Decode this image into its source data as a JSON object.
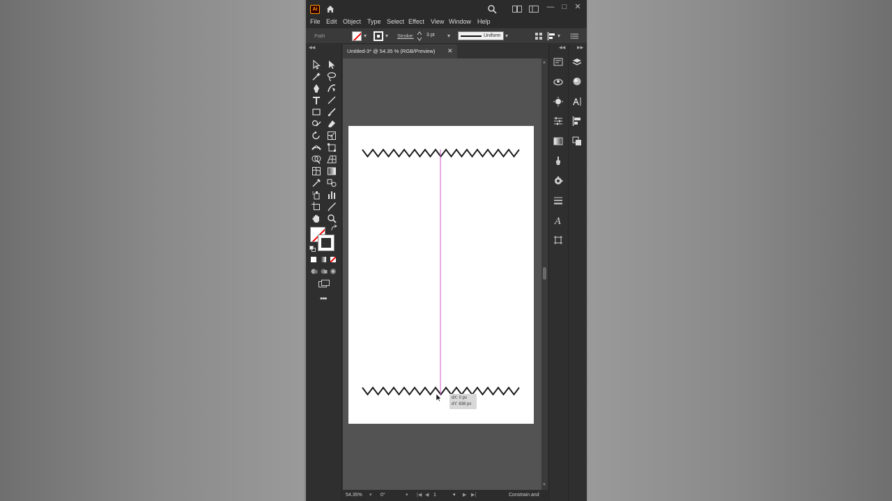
{
  "app": {
    "logo_text": "Ai",
    "accent": "#ff9a00",
    "window_controls": [
      "—",
      "□",
      "✕"
    ]
  },
  "menu": [
    "File",
    "Edit",
    "Object",
    "Type",
    "Select",
    "Effect",
    "View",
    "Window",
    "Help"
  ],
  "control_bar": {
    "selection_label": "Path",
    "stroke_label": "Stroke:",
    "stroke_weight": "3 pt",
    "profile": "Uniform"
  },
  "document": {
    "tab_title": "Untitled-3* @ 54.35 % (RGB/Preview)",
    "close_glyph": "✕"
  },
  "canvas": {
    "guide_color": "#cc55cc",
    "tooltip": {
      "dx": "dX: 0 px",
      "dy": "dY: 638 px"
    }
  },
  "status_bar": {
    "zoom": "54.35%",
    "rotation": "0°",
    "artboard": "1",
    "info": "Constrain and Cop"
  },
  "icons": {
    "tools": [
      "selection-icon",
      "direct-selection-icon",
      "magic-wand-icon",
      "lasso-icon",
      "pen-icon",
      "curvature-icon",
      "type-icon",
      "line-segment-icon",
      "rectangle-icon",
      "paintbrush-icon",
      "shaper-icon",
      "eraser-icon",
      "rotate-icon",
      "scale-icon",
      "width-icon",
      "free-transform-icon",
      "shape-builder-icon",
      "perspective-grid-icon",
      "mesh-icon",
      "gradient-icon",
      "eyedropper-icon",
      "blend-icon",
      "symbol-sprayer-icon",
      "column-graph-icon",
      "artboard-icon",
      "slice-icon",
      "hand-icon",
      "zoom-icon"
    ],
    "dock": [
      "properties-icon",
      "layers-icon",
      "libraries-icon",
      "appearance-icon",
      "color-icon",
      "character-icon",
      "transform-icon",
      "align-icon",
      "gradient-panel-icon",
      "pathfinder-icon",
      "brushes-icon",
      "symbols-icon",
      "stroke-panel-icon",
      "graphic-styles-icon",
      "artboards-panel-icon"
    ]
  }
}
